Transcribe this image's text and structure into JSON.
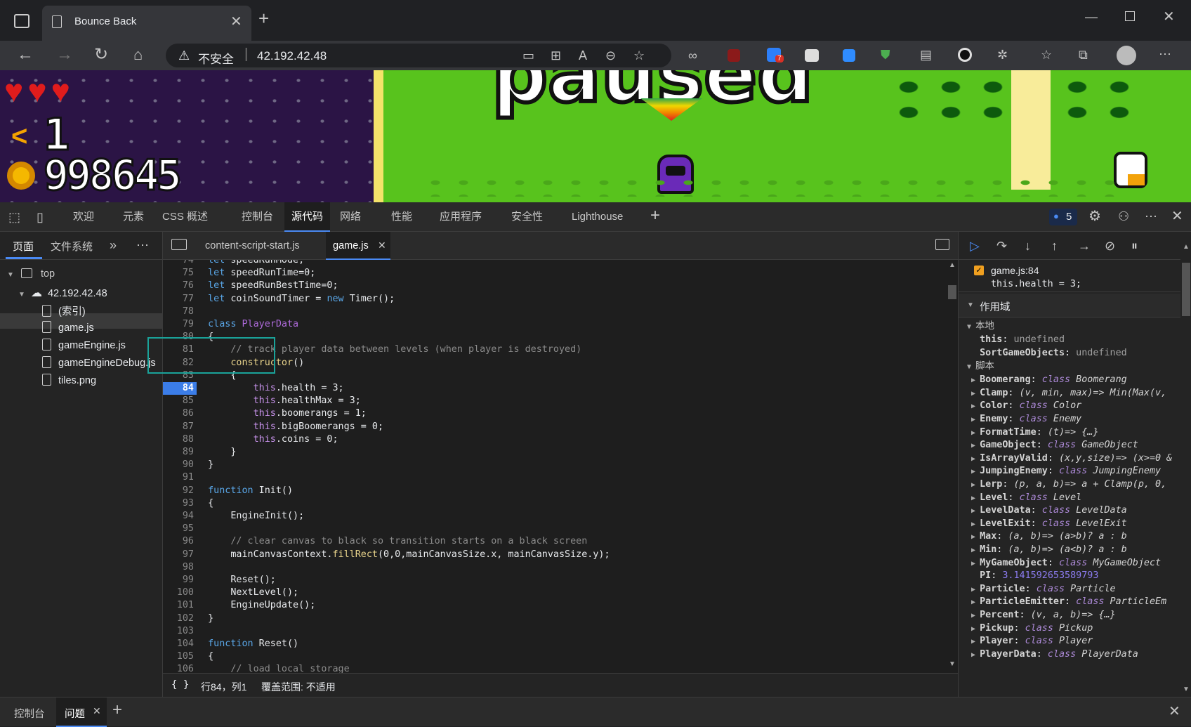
{
  "browser": {
    "tab_title": "Bounce Back",
    "security_label": "不安全",
    "url": "42.192.42.48",
    "ext_badge": "7"
  },
  "game": {
    "hearts": 3,
    "boomerang_count": "1",
    "coin_count": "998645",
    "paused_text": "paused"
  },
  "devtools": {
    "tabs": [
      "欢迎",
      "元素",
      "CSS 概述",
      "控制台",
      "源代码",
      "网络",
      "性能",
      "应用程序",
      "安全性",
      "Lighthouse"
    ],
    "active_tab": "源代码",
    "issues_count": "5",
    "nav_tabs": [
      "页面",
      "文件系统"
    ],
    "tree": {
      "top": "top",
      "host": "42.192.42.48",
      "files": [
        "(索引)",
        "game.js",
        "gameEngine.js",
        "gameEngineDebug.js",
        "tiles.png"
      ]
    },
    "editor_tabs": [
      "content-script-start.js",
      "game.js"
    ],
    "breakpoint_line": "84",
    "code_lines": [
      {
        "n": "74",
        "t": "let speedRunMode;"
      },
      {
        "n": "75",
        "t": "let speedRunTime=0;"
      },
      {
        "n": "76",
        "t": "let speedRunBestTime=0;"
      },
      {
        "n": "77",
        "t": "let coinSoundTimer = new Timer();"
      },
      {
        "n": "78",
        "t": ""
      },
      {
        "n": "79",
        "t": "class PlayerData"
      },
      {
        "n": "80",
        "t": "{"
      },
      {
        "n": "81",
        "t": "    // track player data between levels (when player is destroyed)"
      },
      {
        "n": "82",
        "t": "    constructor()"
      },
      {
        "n": "83",
        "t": "    {"
      },
      {
        "n": "84",
        "t": "        this.health = 3;"
      },
      {
        "n": "85",
        "t": "        this.healthMax = 3;"
      },
      {
        "n": "86",
        "t": "        this.boomerangs = 1;"
      },
      {
        "n": "87",
        "t": "        this.bigBoomerangs = 0;"
      },
      {
        "n": "88",
        "t": "        this.coins = 0;"
      },
      {
        "n": "89",
        "t": "    }"
      },
      {
        "n": "90",
        "t": "}"
      },
      {
        "n": "91",
        "t": ""
      },
      {
        "n": "92",
        "t": "function Init()"
      },
      {
        "n": "93",
        "t": "{"
      },
      {
        "n": "94",
        "t": "    EngineInit();"
      },
      {
        "n": "95",
        "t": ""
      },
      {
        "n": "96",
        "t": "    // clear canvas to black so transition starts on a black screen"
      },
      {
        "n": "97",
        "t": "    mainCanvasContext.fillRect(0,0,mainCanvasSize.x, mainCanvasSize.y);"
      },
      {
        "n": "98",
        "t": ""
      },
      {
        "n": "99",
        "t": "    Reset();"
      },
      {
        "n": "100",
        "t": "    NextLevel();"
      },
      {
        "n": "101",
        "t": "    EngineUpdate();"
      },
      {
        "n": "102",
        "t": "}"
      },
      {
        "n": "103",
        "t": ""
      },
      {
        "n": "104",
        "t": "function Reset()"
      },
      {
        "n": "105",
        "t": "{"
      },
      {
        "n": "106",
        "t": "    // load local storage"
      }
    ],
    "status_bar": {
      "braces": "{ }",
      "position": "行84，列1",
      "coverage": "覆盖范围: 不适用"
    },
    "breakpoint_panel": {
      "file_line": "game.js:84",
      "code": "this.health = 3;"
    },
    "scope": {
      "title": "作用域",
      "local_title": "本地",
      "local": [
        {
          "k": "this",
          "v": "undefined"
        },
        {
          "k": "SortGameObjects",
          "v": "undefined"
        }
      ],
      "script_title": "脚本",
      "script": [
        {
          "k": "Boomerang",
          "v": "class Boomerang"
        },
        {
          "k": "Clamp",
          "v": "(v, min, max)=> Min(Max(v,"
        },
        {
          "k": "Color",
          "v": "class Color"
        },
        {
          "k": "Enemy",
          "v": "class Enemy"
        },
        {
          "k": "FormatTime",
          "v": "(t)=> {…}"
        },
        {
          "k": "GameObject",
          "v": "class GameObject"
        },
        {
          "k": "IsArrayValid",
          "v": "(x,y,size)=> (x>=0 &"
        },
        {
          "k": "JumpingEnemy",
          "v": "class JumpingEnemy"
        },
        {
          "k": "Lerp",
          "v": "(p, a, b)=> a + Clamp(p, 0,"
        },
        {
          "k": "Level",
          "v": "class Level"
        },
        {
          "k": "LevelData",
          "v": "class LevelData"
        },
        {
          "k": "LevelExit",
          "v": "class LevelExit"
        },
        {
          "k": "Max",
          "v": "(a, b)=> (a>b)? a : b"
        },
        {
          "k": "Min",
          "v": "(a, b)=> (a<b)? a : b"
        },
        {
          "k": "MyGameObject",
          "v": "class MyGameObject"
        },
        {
          "k": "PI",
          "v": "3.141592653589793"
        },
        {
          "k": "Particle",
          "v": "class Particle"
        },
        {
          "k": "ParticleEmitter",
          "v": "class ParticleEm"
        },
        {
          "k": "Percent",
          "v": "(v, a, b)=> {…}"
        },
        {
          "k": "Pickup",
          "v": "class Pickup"
        },
        {
          "k": "Player",
          "v": "class Player"
        },
        {
          "k": "PlayerData",
          "v": "class PlayerData"
        }
      ]
    },
    "drawer_tabs": [
      "控制台",
      "问题"
    ]
  },
  "colors": {
    "accent": "#4a8af4",
    "breakpoint": "#3b7de8",
    "highlight_box": "#1aa39a"
  }
}
